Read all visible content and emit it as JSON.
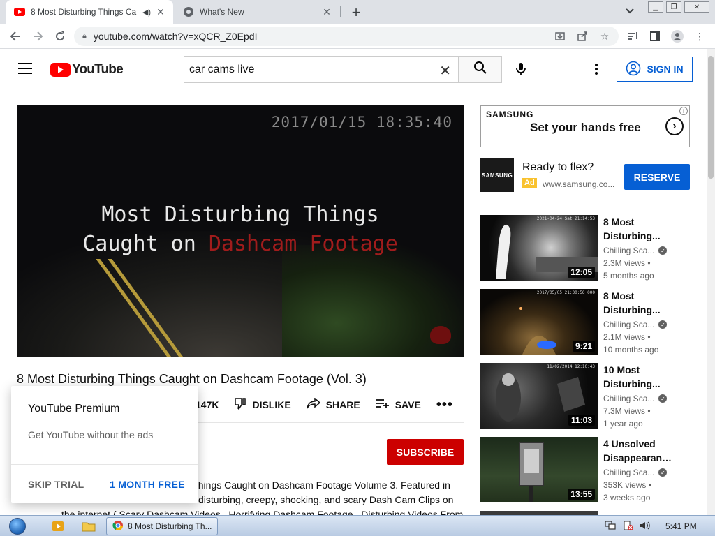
{
  "browser": {
    "tabs": [
      {
        "title": "8 Most Disturbing Things Ca",
        "active": true
      },
      {
        "title": "What's New",
        "active": false
      }
    ],
    "url": "youtube.com/watch?v=xQCR_Z0EpdI"
  },
  "youtube": {
    "logo_text": "YouTube",
    "search_value": "car cams live",
    "sign_in": "SIGN IN"
  },
  "video": {
    "timestamp": "2017/01/15 18:35:40",
    "overlay_line1": "Most Disturbing Things",
    "overlay_line2_white": "Caught on",
    "overlay_line2_red": "Dashcam Footage",
    "title": "8 Most Disturbing Things Caught on Dashcam Footage (Vol. 3)",
    "likes": "147K",
    "dislike": "DISLIKE",
    "share": "SHARE",
    "save": "SAVE",
    "subscribe": "SUBSCRIBE",
    "description": [
      "ng Things Caught on Dashcam Footage Volume 3. Featured in",
      "disturbing, creepy, shocking, and scary Dash Cam Clips on",
      "the internet ( Scary Dashcam Videos , Horrifying Dashcam Footage , Disturbing Videos From"
    ]
  },
  "premium_popup": {
    "title": "YouTube Premium",
    "subtitle": "Get YouTube without the ads",
    "skip": "SKIP TRIAL",
    "free": "1 MONTH FREE"
  },
  "ad": {
    "brand": "SAMSUNG",
    "tagline": "Set your hands free",
    "title": "Ready to flex?",
    "badge": "Ad",
    "url": "www.samsung.co...",
    "cta": "RESERVE"
  },
  "recommendations": [
    {
      "title1": "8 Most",
      "title2": "Disturbing...",
      "channel": "Chilling Sca...",
      "views": "2.3M views •",
      "age": "5 months ago",
      "duration": "12:05",
      "ts": "2021-04-24 Sat 21:14:53"
    },
    {
      "title1": "8 Most",
      "title2": "Disturbing...",
      "channel": "Chilling Sca...",
      "views": "2.1M views •",
      "age": "10 months ago",
      "duration": "9:21",
      "ts": "2017/05/05 21:30:56 000"
    },
    {
      "title1": "10 Most",
      "title2": "Disturbing...",
      "channel": "Chilling Sca...",
      "views": "7.3M views •",
      "age": "1 year ago",
      "duration": "11:03",
      "ts": "11/02/2014 12:10:43"
    },
    {
      "title1": "4 Unsolved",
      "title2": "Disappearanc...",
      "channel": "Chilling Sca...",
      "views": "353K views •",
      "age": "3 weeks ago",
      "duration": "13:55",
      "ts": ""
    }
  ],
  "taskbar": {
    "task_title": "8 Most Disturbing Th...",
    "clock": "5:41 PM"
  }
}
